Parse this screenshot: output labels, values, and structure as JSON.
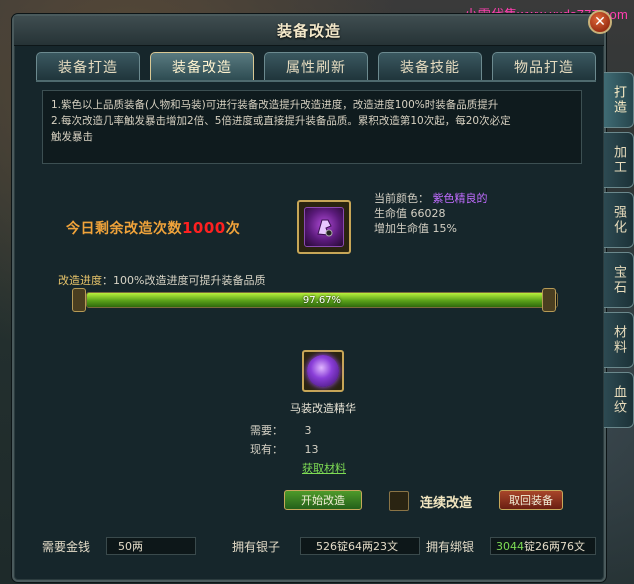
{
  "watermark": "小雪代售www.xxds777.com",
  "window": {
    "title": "装备改造",
    "close_label": "✕"
  },
  "tabs": [
    {
      "label": "装备打造",
      "active": false
    },
    {
      "label": "装备改造",
      "active": true
    },
    {
      "label": "属性刷新",
      "active": false
    },
    {
      "label": "装备技能",
      "active": false
    },
    {
      "label": "物品打造",
      "active": false
    }
  ],
  "side_tabs": [
    {
      "label": "打造",
      "active": true
    },
    {
      "label": "加工",
      "active": false
    },
    {
      "label": "强化",
      "active": false
    },
    {
      "label": "宝石",
      "active": false
    },
    {
      "label": "材料",
      "active": false
    },
    {
      "label": "血纹",
      "active": false
    }
  ],
  "info": {
    "line1": "1.紫色以上品质装备(人物和马装)可进行装备改造提升改造进度，改造进度100%时装备品质提升",
    "line2": "2.每次改造几率触发暴击增加2倍、5倍进度或直接提升装备品质。累积改造第10次起，每20次必定",
    "line3": "触发暴击"
  },
  "remaining": {
    "prefix": "今日剩余改造次数",
    "count": "1000",
    "suffix": "次"
  },
  "equipment": {
    "color_label": "当前颜色：",
    "color_value": "紫色精良的",
    "hp_label": "生命值",
    "hp_value": "66028",
    "hp_bonus_label": "增加生命值",
    "hp_bonus_value": "15%",
    "icon": "purple-horse-gear-icon"
  },
  "progress": {
    "label": "改造进度",
    "desc": "：100%改造进度可提升装备品质",
    "value": 97.67,
    "display": "97.67%"
  },
  "material": {
    "name": "马装改造精华",
    "need_label": "需要：",
    "need_value": "3",
    "have_label": "现有：",
    "have_value": "13",
    "get_link": "获取材料",
    "icon": "purple-essence-orb-icon"
  },
  "buttons": {
    "start": "开始改造",
    "continuous": "连续改造",
    "withdraw": "取回装备"
  },
  "footer": {
    "gold_label": "需要金钱",
    "gold_value": "50两",
    "silver_label": "拥有银子",
    "silver_value": "526锭64两23文",
    "bound_label": "拥有绑银",
    "bound_value_green": "3044",
    "bound_value_rest": "锭26两76文"
  },
  "colors": {
    "accent_gold": "#c7a657",
    "progress_green": "#5aa11a",
    "quality_purple": "#c06cff",
    "remaining_orange": "#f0a33a",
    "remaining_red": "#ff2020"
  }
}
